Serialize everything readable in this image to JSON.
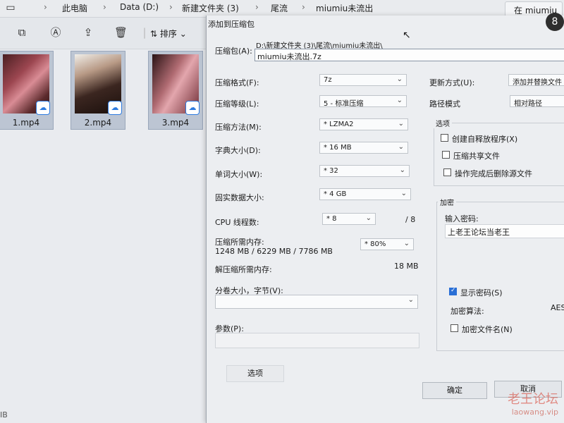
{
  "explorer": {
    "breadcrumb": [
      "此电脑",
      "Data (D:)",
      "新建文件夹 (3)",
      "尾流",
      "miumiu未流出"
    ],
    "search_text": "在 miumiu",
    "sort_label": "排序",
    "files": [
      {
        "name": "1.mp4"
      },
      {
        "name": "2.mp4"
      },
      {
        "name": "3.mp4"
      }
    ],
    "status_size": "IB"
  },
  "dialog": {
    "title": "添加到压缩包",
    "archive_label": "压缩包(A):",
    "archive_path": "D:\\新建文件夹 (3)\\尾流\\miumiu未流出\\",
    "archive_name": "miumiu未流出.7z",
    "format_label": "压缩格式(F):",
    "format_value": "7z",
    "level_label": "压缩等级(L):",
    "level_value": "5 - 标准压缩",
    "method_label": "压缩方法(M):",
    "method_value": "* LZMA2",
    "dict_label": "字典大小(D):",
    "dict_value": "* 16 MB",
    "word_label": "单词大小(W):",
    "word_value": "* 32",
    "solid_label": "固实数据大小:",
    "solid_value": "* 4 GB",
    "threads_label": "CPU 线程数:",
    "threads_value": "* 8",
    "threads_max": "/ 8",
    "mem_comp_label": "压缩所需内存:",
    "mem_comp_value": "1248 MB / 6229 MB / 7786 MB",
    "mem_percent": "* 80%",
    "mem_decomp_label": "解压缩所需内存:",
    "mem_decomp_value": "18 MB",
    "split_label": "分卷大小，字节(V):",
    "params_label": "参数(P):",
    "options_button": "选项",
    "update_label": "更新方式(U):",
    "update_value": "添加并替换文件",
    "path_label": "路径模式",
    "path_value": "相对路径",
    "options_group": "选项",
    "opt_sfx": "创建自释放程序(X)",
    "opt_shared": "压缩共享文件",
    "opt_delete": "操作完成后删除源文件",
    "enc_group": "加密",
    "enc_password_label": "输入密码:",
    "enc_password_value": "上老王论坛当老王",
    "enc_show_password": "显示密码(S)",
    "enc_method_label": "加密算法:",
    "enc_method_value": "AES",
    "enc_filenames": "加密文件名(N)",
    "ok_button": "确定",
    "cancel_button": "取消"
  },
  "watermark": {
    "text": "老王论坛",
    "url": "laowang.vip"
  }
}
